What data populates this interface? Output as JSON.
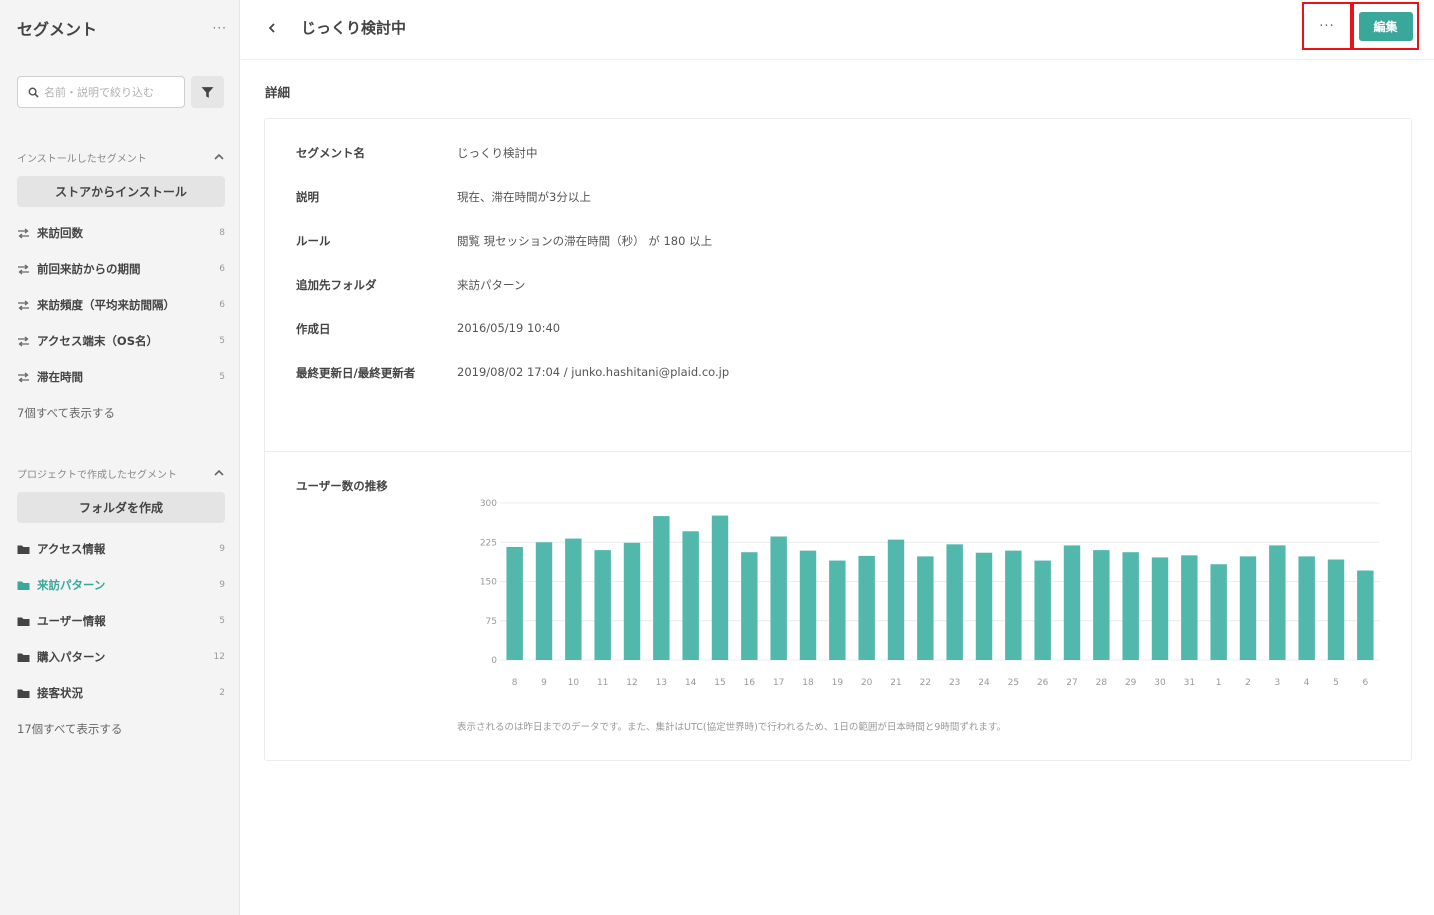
{
  "sidebar": {
    "title": "セグメント",
    "more": "···",
    "search_placeholder": "名前・説明で絞り込む",
    "installed": {
      "heading": "インストールしたセグメント",
      "button": "ストアからインストール",
      "items": [
        {
          "label": "来訪回数",
          "count": "8"
        },
        {
          "label": "前回来訪からの期間",
          "count": "6"
        },
        {
          "label": "来訪頻度（平均来訪間隔）",
          "count": "6"
        },
        {
          "label": "アクセス端末（OS名）",
          "count": "5"
        },
        {
          "label": "滞在時間",
          "count": "5"
        }
      ],
      "show_all": "7個すべて表示する"
    },
    "project": {
      "heading": "プロジェクトで作成したセグメント",
      "button": "フォルダを作成",
      "items": [
        {
          "label": "アクセス情報",
          "count": "9"
        },
        {
          "label": "来訪パターン",
          "count": "9",
          "active": true
        },
        {
          "label": "ユーザー情報",
          "count": "5"
        },
        {
          "label": "購入パターン",
          "count": "12"
        },
        {
          "label": "接客状況",
          "count": "2"
        }
      ],
      "show_all": "17個すべて表示する"
    }
  },
  "header": {
    "title": "じっくり検討中",
    "more": "···",
    "edit": "編集"
  },
  "details": {
    "section_title": "詳細",
    "rows": [
      {
        "label": "セグメント名",
        "value": "じっくり検討中"
      },
      {
        "label": "説明",
        "value": "現在、滞在時間が3分以上"
      },
      {
        "label": "ルール",
        "value": "閲覧 現セッションの滞在時間（秒） が 180 以上"
      },
      {
        "label": "追加先フォルダ",
        "value": "来訪パターン"
      },
      {
        "label": "作成日",
        "value": "2016/05/19 10:40"
      },
      {
        "label": "最終更新日/最終更新者",
        "value": "2019/08/02 17:04 / junko.hashitani@plaid.co.jp"
      }
    ],
    "chart_title": "ユーザー数の推移",
    "note": "表示されるのは昨日までのデータです。また、集計はUTC(協定世界時)で行われるため、1日の範囲が日本時間と9時間ずれます。"
  },
  "colors": {
    "accent": "#3aa79b",
    "bar": "#52b8ac",
    "highlight": "#e8141b"
  },
  "chart_data": {
    "type": "bar",
    "categories": [
      "8",
      "9",
      "10",
      "11",
      "12",
      "13",
      "14",
      "15",
      "16",
      "17",
      "18",
      "19",
      "20",
      "21",
      "22",
      "23",
      "24",
      "25",
      "26",
      "27",
      "28",
      "29",
      "30",
      "31",
      "1",
      "2",
      "3",
      "4",
      "5",
      "6"
    ],
    "values": [
      216,
      225,
      232,
      210,
      224,
      275,
      246,
      276,
      206,
      236,
      209,
      190,
      199,
      230,
      198,
      221,
      205,
      209,
      190,
      219,
      210,
      206,
      196,
      200,
      183,
      198,
      219,
      198,
      192,
      171
    ],
    "yticks": [
      0,
      75,
      150,
      225,
      300
    ],
    "ylim": [
      0,
      300
    ],
    "grid": true,
    "xlabel": "",
    "ylabel": ""
  }
}
